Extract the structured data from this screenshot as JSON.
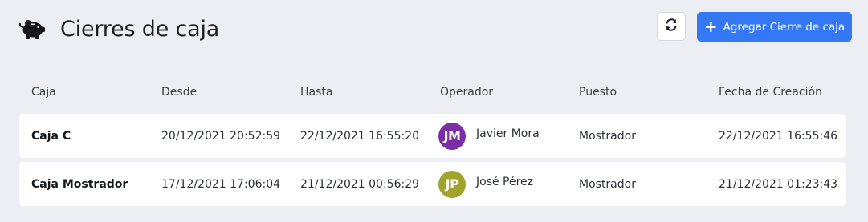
{
  "header": {
    "title": "Cierres de caja",
    "add_label": "Agregar Cierre de caja"
  },
  "table": {
    "columns": [
      "Caja",
      "Desde",
      "Hasta",
      "Operador",
      "Puesto",
      "Fecha de Creación"
    ],
    "rows": [
      {
        "caja": "Caja C",
        "desde": "20/12/2021 20:52:59",
        "hasta": "22/12/2021 16:55:20",
        "operador_initials": "JM",
        "operador": "Javier Mora",
        "avatar_color": "#7b2fa5",
        "puesto": "Mostrador",
        "fecha_creacion": "22/12/2021 16:55:46"
      },
      {
        "caja": "Caja Mostrador",
        "desde": "17/12/2021 17:06:04",
        "hasta": "21/12/2021 00:56:29",
        "operador_initials": "JP",
        "operador": "José Pérez",
        "avatar_color": "#a0a42b",
        "puesto": "Mostrador",
        "fecha_creacion": "21/12/2021 01:23:43"
      }
    ]
  },
  "colors": {
    "background": "#eceef3",
    "accent": "#3478f6"
  },
  "icons": {
    "title": "piggy-bank-icon",
    "refresh": "refresh-icon",
    "add": "plus-icon"
  }
}
